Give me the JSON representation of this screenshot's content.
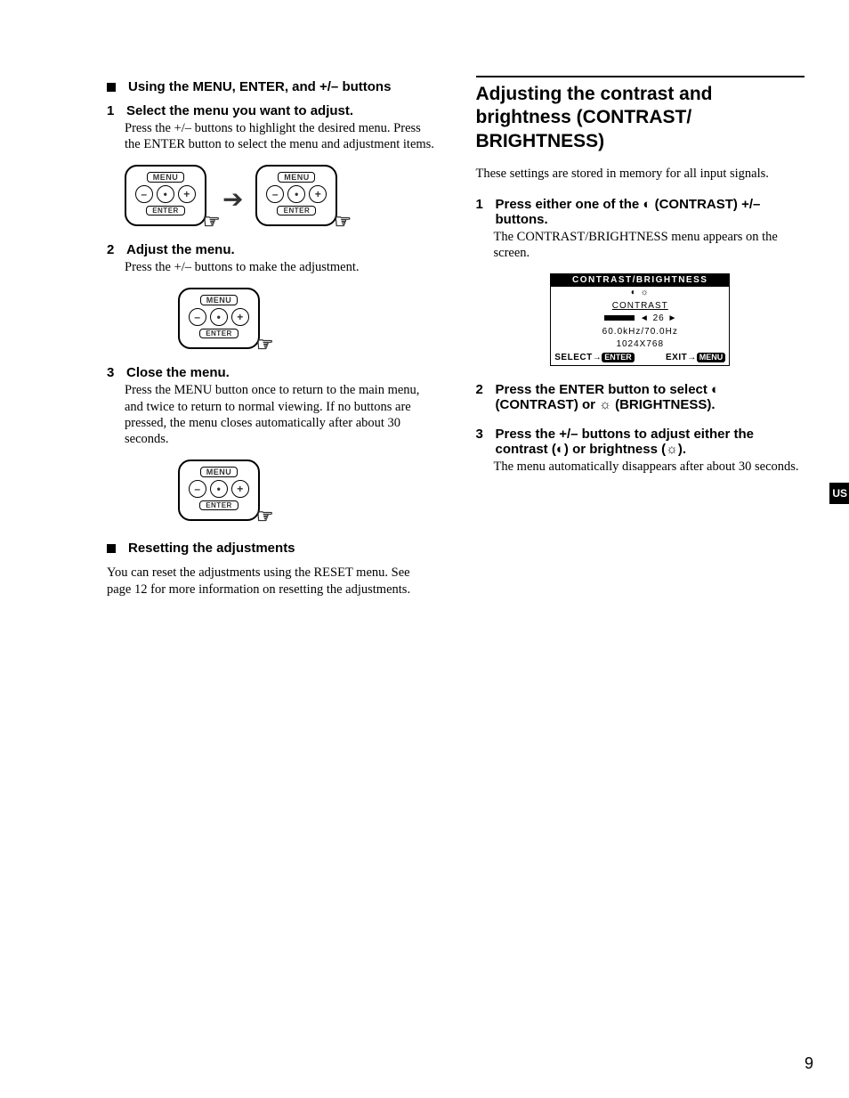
{
  "left": {
    "head1": "Using the MENU, ENTER, and +/– buttons",
    "step1": {
      "n": "1",
      "title": "Select the menu you want to adjust.",
      "body": "Press the +/– buttons to highlight the desired menu. Press the ENTER button to select the menu and adjustment items."
    },
    "step2": {
      "n": "2",
      "title": "Adjust the menu.",
      "body": "Press the +/– buttons to make the adjustment."
    },
    "step3": {
      "n": "3",
      "title": "Close the menu.",
      "body": "Press the MENU button once to return to the main menu, and twice to return to normal viewing. If no buttons are pressed, the menu closes automatically after about 30 seconds."
    },
    "head2": "Resetting the adjustments",
    "resetBody": "You can reset the adjustments using the RESET menu. See page 12 for more information on resetting the adjustments.",
    "illus": {
      "menuLabel": "MENU",
      "enterLabel": "ENTER",
      "minus": "–",
      "plus": "+",
      "dot": "•",
      "arrow": "➔"
    }
  },
  "right": {
    "h2": "Adjusting the contrast and brightness (CONTRAST/ BRIGHTNESS)",
    "intro": "These settings are stored in memory for all input signals.",
    "step1": {
      "n": "1",
      "title": "Press either one of the ◐ (CONTRAST) +/– buttons.",
      "body": "The CONTRAST/BRIGHTNESS menu appears on the screen."
    },
    "step2": {
      "n": "2",
      "title": "Press the ENTER button to select ◐ (CONTRAST) or ☼ (BRIGHTNESS)."
    },
    "step3": {
      "n": "3",
      "title": "Press the +/– buttons to adjust either the contrast (◐) or brightness (☼).",
      "body": "The menu automatically disappears after about 30 seconds."
    },
    "osd": {
      "title": "CONTRAST/BRIGHTNESS",
      "iconsRow": "◐   ☼",
      "label": "CONTRAST",
      "value": "26",
      "freq": "60.0kHz/70.0Hz",
      "res": "1024X768",
      "selectWord": "SELECT",
      "selectTag": "ENTER",
      "exitWord": "EXIT",
      "exitTag": "MENU",
      "arrowLeft": "◄",
      "arrowRight": "►",
      "smallArrow": "→"
    }
  },
  "tab": "US",
  "pageNumber": "9"
}
